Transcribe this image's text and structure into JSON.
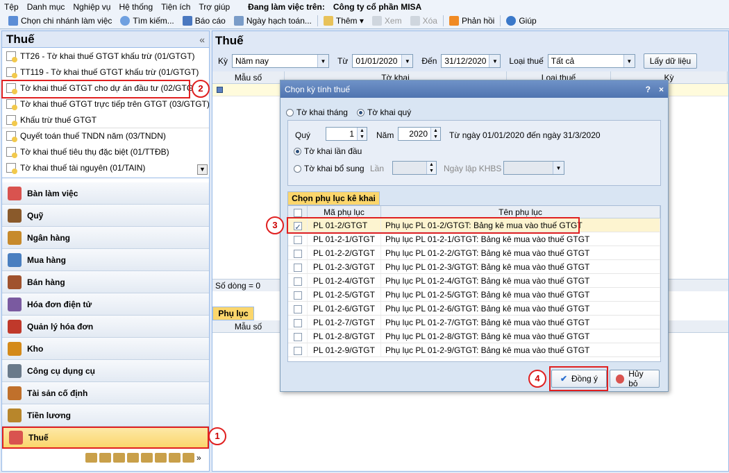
{
  "menu": {
    "items": [
      "Tệp",
      "Danh mục",
      "Nghiệp vụ",
      "Hệ thống",
      "Tiện ích",
      "Trợ giúp"
    ],
    "work_label": "Đang làm việc trên:",
    "company": "Công ty cổ phần MISA"
  },
  "toolbar": {
    "branch": "Chọn chi nhánh làm việc",
    "search": "Tìm kiếm...",
    "report": "Báo cáo",
    "date": "Ngày hạch toán...",
    "add": "Thêm",
    "view": "Xem",
    "delete": "Xóa",
    "feedback": "Phản hồi",
    "help": "Giúp"
  },
  "left": {
    "title": "Thuế",
    "collapse": "«",
    "tax_items": [
      "TT26 - Tờ khai thuế GTGT khấu trừ (01/GTGT)",
      "TT119 - Tờ khai thuế GTGT khấu trừ (01/GTGT)",
      "Tờ khai thuế GTGT cho dự án đầu tư (02/GTGT)",
      "Tờ khai thuế GTGT trực tiếp trên GTGT (03/GTGT)",
      "Khấu trừ thuế GTGT",
      "Quyết toán thuế TNDN năm (03/TNDN)",
      "Tờ khai thuế tiêu thụ đặc biệt (01/TTĐB)",
      "Tờ khai thuế tài nguyên (01/TAIN)"
    ],
    "modules": [
      "Bàn làm việc",
      "Quỹ",
      "Ngân hàng",
      "Mua hàng",
      "Bán hàng",
      "Hóa đơn điện tử",
      "Quản lý hóa đơn",
      "Kho",
      "Công cụ dụng cụ",
      "Tài sản cố định",
      "Tiền lương",
      "Thuế"
    ],
    "module_colors": [
      "#d9534f",
      "#8a5a2b",
      "#c78a2b",
      "#4a7fc0",
      "#a0522d",
      "#7a5aa0",
      "#c0392b",
      "#d48a1a",
      "#6a7a8a",
      "#c0702b",
      "#b8862b",
      "#d9534f"
    ]
  },
  "main": {
    "title": "Thuế",
    "filter": {
      "period_label": "Kỳ",
      "period_value": "Năm nay",
      "from_label": "Từ",
      "from_value": "01/01/2020",
      "to_label": "Đến",
      "to_value": "31/12/2020",
      "type_label": "Loại thuế",
      "type_value": "Tất cả",
      "get_button": "Lấy dữ liệu"
    },
    "columns": [
      "Mẫu số",
      "Tờ khai",
      "Loại thuế",
      "Kỳ"
    ],
    "row_count": "Số dòng = 0",
    "sub_tab": "Phụ lục",
    "sub_column": "Mẫu số"
  },
  "dialog": {
    "title": "Chọn kỳ tính thuế",
    "help": "?",
    "close": "×",
    "monthly": "Tờ khai tháng",
    "quarterly": "Tờ khai quý",
    "quarter_label": "Quý",
    "quarter_value": "1",
    "year_label": "Năm",
    "year_value": "2020",
    "range_text": "Từ ngày 01/01/2020 đến ngày 31/3/2020",
    "first": "Tờ khai lần đầu",
    "supplement": "Tờ khai bổ sung",
    "times_label": "Lần",
    "khbs_label": "Ngày lập KHBS",
    "appendix_tab": "Chọn phụ lục kê khai",
    "col_code": "Mã phụ lục",
    "col_name": "Tên phụ lục",
    "rows": [
      {
        "code": "PL 01-2/GTGT",
        "name": "Phụ lục PL 01-2/GTGT: Bảng kê mua vào thuế GTGT",
        "checked": true
      },
      {
        "code": "PL 01-2-1/GTGT",
        "name": "Phụ lục PL 01-2-1/GTGT: Bảng kê mua vào thuế GTGT",
        "checked": false
      },
      {
        "code": "PL 01-2-2/GTGT",
        "name": "Phụ lục PL 01-2-2/GTGT: Bảng kê mua vào thuế GTGT",
        "checked": false
      },
      {
        "code": "PL 01-2-3/GTGT",
        "name": "Phụ lục PL 01-2-3/GTGT: Bảng kê mua vào thuế GTGT",
        "checked": false
      },
      {
        "code": "PL 01-2-4/GTGT",
        "name": "Phụ lục PL 01-2-4/GTGT: Bảng kê mua vào thuế GTGT",
        "checked": false
      },
      {
        "code": "PL 01-2-5/GTGT",
        "name": "Phụ lục PL 01-2-5/GTGT: Bảng kê mua vào thuế GTGT",
        "checked": false
      },
      {
        "code": "PL 01-2-6/GTGT",
        "name": "Phụ lục PL 01-2-6/GTGT: Bảng kê mua vào thuế GTGT",
        "checked": false
      },
      {
        "code": "PL 01-2-7/GTGT",
        "name": "Phụ lục PL 01-2-7/GTGT: Bảng kê mua vào thuế GTGT",
        "checked": false
      },
      {
        "code": "PL 01-2-8/GTGT",
        "name": "Phụ lục PL 01-2-8/GTGT: Bảng kê mua vào thuế GTGT",
        "checked": false
      },
      {
        "code": "PL 01-2-9/GTGT",
        "name": "Phụ lục PL 01-2-9/GTGT: Bảng kê mua vào thuế GTGT",
        "checked": false
      }
    ],
    "ok": "Đồng ý",
    "cancel": "Hủy bỏ"
  },
  "badges": [
    "1",
    "2",
    "3",
    "4"
  ]
}
